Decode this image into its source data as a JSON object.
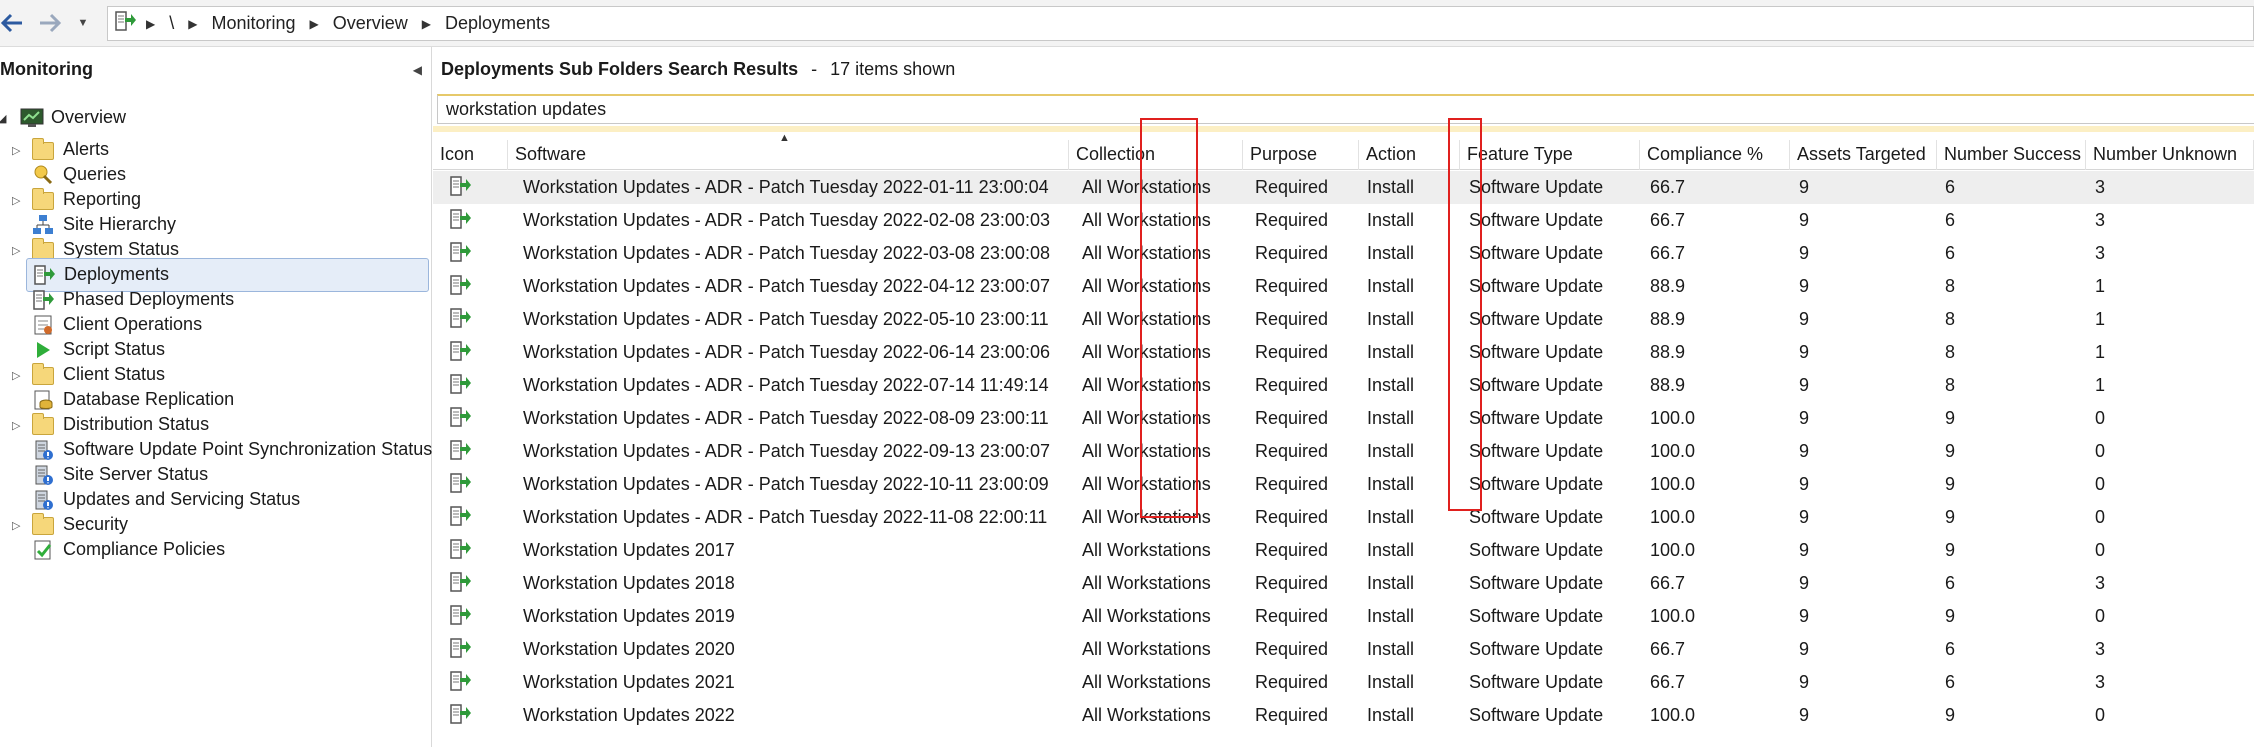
{
  "breadcrumb": {
    "root": "\\",
    "items": [
      "Monitoring",
      "Overview",
      "Deployments"
    ]
  },
  "nav": {
    "title": "Monitoring",
    "overview": "Overview",
    "items": [
      {
        "label": "Alerts",
        "icon": "folder-icon",
        "expand": true
      },
      {
        "label": "Queries",
        "icon": "queries-icon",
        "expand": false
      },
      {
        "label": "Reporting",
        "icon": "folder-icon",
        "expand": true
      },
      {
        "label": "Site Hierarchy",
        "icon": "site-hierarchy-icon",
        "expand": false
      },
      {
        "label": "System Status",
        "icon": "folder-icon",
        "expand": true
      },
      {
        "label": "Deployments",
        "icon": "deployment-icon",
        "expand": false,
        "selected": true
      },
      {
        "label": "Phased Deployments",
        "icon": "deployment-icon",
        "expand": false
      },
      {
        "label": "Client Operations",
        "icon": "client-operations-icon",
        "expand": false
      },
      {
        "label": "Script Status",
        "icon": "script-icon",
        "expand": false
      },
      {
        "label": "Client Status",
        "icon": "folder-icon",
        "expand": true
      },
      {
        "label": "Database Replication",
        "icon": "database-icon",
        "expand": false
      },
      {
        "label": "Distribution Status",
        "icon": "folder-icon",
        "expand": true
      },
      {
        "label": "Software Update Point Synchronization Status",
        "icon": "server-status-icon",
        "expand": false
      },
      {
        "label": "Site Server Status",
        "icon": "server-status-icon",
        "expand": false
      },
      {
        "label": "Updates and Servicing Status",
        "icon": "server-status-icon",
        "expand": false
      },
      {
        "label": "Security",
        "icon": "folder-icon",
        "expand": true
      },
      {
        "label": "Compliance Policies",
        "icon": "compliance-icon",
        "expand": false
      }
    ]
  },
  "results": {
    "title": "Deployments Sub Folders Search Results",
    "separator": "-",
    "count_text": "17 items shown",
    "search_value": "workstation updates"
  },
  "columns": [
    "Icon",
    "Software",
    "Collection",
    "Purpose",
    "Action",
    "Feature Type",
    "Compliance %",
    "Assets Targeted",
    "Number Success",
    "Number Unknown"
  ],
  "rows": [
    {
      "software": "Workstation Updates - ADR - Patch Tuesday 2022-01-11 23:00:04",
      "collection": "All Workstations",
      "purpose": "Required",
      "action": "Install",
      "feature": "Software Update",
      "compliance": "66.7",
      "targeted": "9",
      "success": "6",
      "unknown": "3"
    },
    {
      "software": "Workstation Updates - ADR - Patch Tuesday 2022-02-08 23:00:03",
      "collection": "All Workstations",
      "purpose": "Required",
      "action": "Install",
      "feature": "Software Update",
      "compliance": "66.7",
      "targeted": "9",
      "success": "6",
      "unknown": "3"
    },
    {
      "software": "Workstation Updates - ADR - Patch Tuesday 2022-03-08 23:00:08",
      "collection": "All Workstations",
      "purpose": "Required",
      "action": "Install",
      "feature": "Software Update",
      "compliance": "66.7",
      "targeted": "9",
      "success": "6",
      "unknown": "3"
    },
    {
      "software": "Workstation Updates - ADR - Patch Tuesday 2022-04-12 23:00:07",
      "collection": "All Workstations",
      "purpose": "Required",
      "action": "Install",
      "feature": "Software Update",
      "compliance": "88.9",
      "targeted": "9",
      "success": "8",
      "unknown": "1"
    },
    {
      "software": "Workstation Updates - ADR - Patch Tuesday 2022-05-10 23:00:11",
      "collection": "All Workstations",
      "purpose": "Required",
      "action": "Install",
      "feature": "Software Update",
      "compliance": "88.9",
      "targeted": "9",
      "success": "8",
      "unknown": "1"
    },
    {
      "software": "Workstation Updates - ADR - Patch Tuesday 2022-06-14 23:00:06",
      "collection": "All Workstations",
      "purpose": "Required",
      "action": "Install",
      "feature": "Software Update",
      "compliance": "88.9",
      "targeted": "9",
      "success": "8",
      "unknown": "1"
    },
    {
      "software": "Workstation Updates - ADR - Patch Tuesday 2022-07-14 11:49:14",
      "collection": "All Workstations",
      "purpose": "Required",
      "action": "Install",
      "feature": "Software Update",
      "compliance": "88.9",
      "targeted": "9",
      "success": "8",
      "unknown": "1"
    },
    {
      "software": "Workstation Updates - ADR - Patch Tuesday 2022-08-09 23:00:11",
      "collection": "All Workstations",
      "purpose": "Required",
      "action": "Install",
      "feature": "Software Update",
      "compliance": "100.0",
      "targeted": "9",
      "success": "9",
      "unknown": "0"
    },
    {
      "software": "Workstation Updates - ADR - Patch Tuesday 2022-09-13 23:00:07",
      "collection": "All Workstations",
      "purpose": "Required",
      "action": "Install",
      "feature": "Software Update",
      "compliance": "100.0",
      "targeted": "9",
      "success": "9",
      "unknown": "0"
    },
    {
      "software": "Workstation Updates - ADR - Patch Tuesday 2022-10-11 23:00:09",
      "collection": "All Workstations",
      "purpose": "Required",
      "action": "Install",
      "feature": "Software Update",
      "compliance": "100.0",
      "targeted": "9",
      "success": "9",
      "unknown": "0"
    },
    {
      "software": "Workstation Updates - ADR - Patch Tuesday 2022-11-08 22:00:11",
      "collection": "All Workstations",
      "purpose": "Required",
      "action": "Install",
      "feature": "Software Update",
      "compliance": "100.0",
      "targeted": "9",
      "success": "9",
      "unknown": "0"
    },
    {
      "software": "Workstation Updates 2017",
      "collection": "All Workstations",
      "purpose": "Required",
      "action": "Install",
      "feature": "Software Update",
      "compliance": "100.0",
      "targeted": "9",
      "success": "9",
      "unknown": "0"
    },
    {
      "software": "Workstation Updates 2018",
      "collection": "All Workstations",
      "purpose": "Required",
      "action": "Install",
      "feature": "Software Update",
      "compliance": "66.7",
      "targeted": "9",
      "success": "6",
      "unknown": "3"
    },
    {
      "software": "Workstation Updates 2019",
      "collection": "All Workstations",
      "purpose": "Required",
      "action": "Install",
      "feature": "Software Update",
      "compliance": "100.0",
      "targeted": "9",
      "success": "9",
      "unknown": "0"
    },
    {
      "software": "Workstation Updates 2020",
      "collection": "All Workstations",
      "purpose": "Required",
      "action": "Install",
      "feature": "Software Update",
      "compliance": "66.7",
      "targeted": "9",
      "success": "6",
      "unknown": "3"
    },
    {
      "software": "Workstation Updates 2021",
      "collection": "All Workstations",
      "purpose": "Required",
      "action": "Install",
      "feature": "Software Update",
      "compliance": "66.7",
      "targeted": "9",
      "success": "6",
      "unknown": "3"
    },
    {
      "software": "Workstation Updates 2022",
      "collection": "All Workstations",
      "purpose": "Required",
      "action": "Install",
      "feature": "Software Update",
      "compliance": "100.0",
      "targeted": "9",
      "success": "9",
      "unknown": "0"
    }
  ],
  "colors": {
    "highlight_box": "#e0201e",
    "selected_bg": "#e5edf8",
    "search_accent": "#e6c96a"
  }
}
